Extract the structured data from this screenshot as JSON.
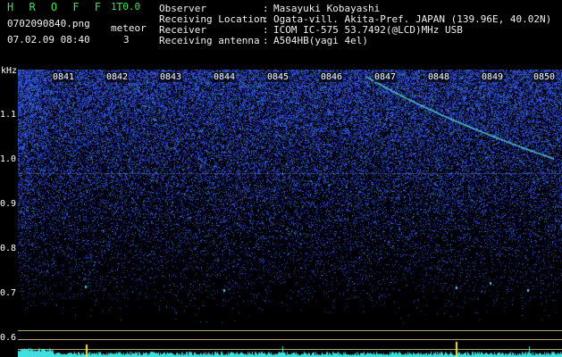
{
  "header": {
    "app_title": "H R O F F T",
    "app_version": "1.0.0",
    "file_name": "0702090840.png",
    "meteor_label": "meteor",
    "date_time": "07.02.09 08:40",
    "meteor_count": "3"
  },
  "info": [
    {
      "label": "Observer",
      "value": "Masayuki Kobayashi"
    },
    {
      "label": "Receiving Location",
      "value": "Ogata-vill. Akita-Pref. JAPAN (139.96E, 40.02N)"
    },
    {
      "label": "Receiver",
      "value": "ICOM IC-575 53.7492(@LCD)MHz USB"
    },
    {
      "label": "Receiving antenna",
      "value": "A504HB(yagi 4el)"
    }
  ],
  "separator": ":",
  "spectrogram": {
    "y_unit": "kHz",
    "y_ticks": [
      "1.1",
      "1.0",
      "0.9",
      "0.8",
      "0.7",
      "0.6"
    ],
    "time_ticks": [
      "0841",
      "0842",
      "0843",
      "0844",
      "0845",
      "0846",
      "0847",
      "0848",
      "0849",
      "0850"
    ],
    "colors": {
      "background": "#000000",
      "noise": "#2040c8",
      "trace": "#40e0e0",
      "ticks": "#ffffff",
      "hline": "#b0a070"
    }
  }
}
